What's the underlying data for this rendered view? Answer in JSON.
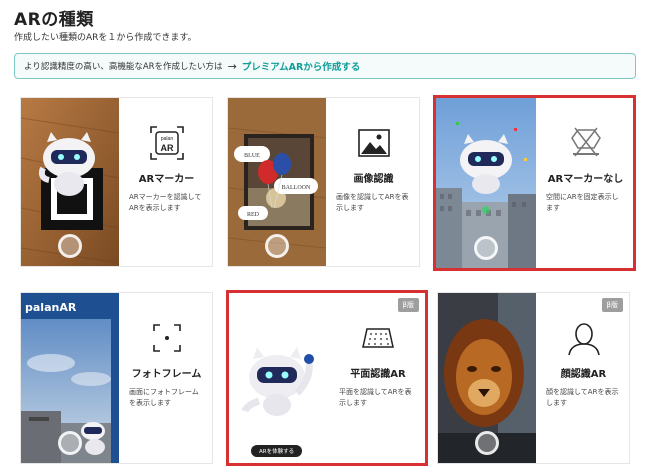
{
  "header": {
    "title": "ARの種類",
    "subtitle": "作成したい種類のARを１から作成できます。"
  },
  "notice": {
    "text": "より認識精度の高い、高機能なARを作成したい方は",
    "arrow": "→",
    "link": "プレミアムARから作成する"
  },
  "cards": [
    {
      "name": "ARマーカー",
      "desc": "ARマーカーを認識して\nARを表示します",
      "icon": "palan-ar-marker-icon",
      "selected": false
    },
    {
      "name": "画像認識",
      "desc": "画像を認識してARを表\n示します",
      "icon": "image-icon",
      "selected": false
    },
    {
      "name": "ARマーカーなし",
      "desc": "空間にARを固定表示し\nます",
      "icon": "no-marker-icon",
      "selected": true
    },
    {
      "name": "フォトフレーム",
      "desc": "画面にフォトフレーム\nを表示します",
      "icon": "focus-frame-icon",
      "selected": false
    },
    {
      "name": "平面認識AR",
      "desc": "平面を認識してARを表\n示します",
      "icon": "plane-grid-icon",
      "selected": true,
      "badge": "β版",
      "button": "ARを体験する"
    },
    {
      "name": "顔認識AR",
      "desc": "顔を認識してARを表示\nします",
      "icon": "face-icon",
      "selected": false,
      "badge": "β版"
    }
  ],
  "photo_texts": {
    "palan_logo": "palanAR",
    "marker_icon_label_top": "palan",
    "marker_icon_label_bottom": "AR",
    "balloon_1": "BLUE",
    "balloon_2": "BALLOON",
    "balloon_3": "RED"
  },
  "colors": {
    "accent": "#0e9d98",
    "selected_border": "#d73033",
    "notice_border": "#7fc8c6"
  }
}
